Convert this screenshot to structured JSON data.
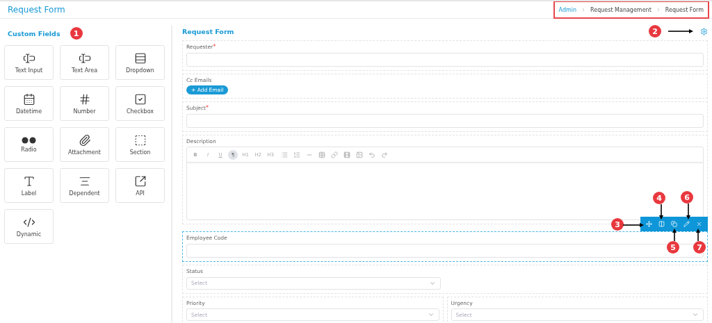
{
  "header": {
    "title": "Request Form",
    "breadcrumb": [
      {
        "label": "Admin",
        "link": true
      },
      {
        "label": "Request Management",
        "link": false
      },
      {
        "label": "Request Form",
        "link": false
      }
    ]
  },
  "custom_fields": {
    "title": "Custom Fields",
    "items": [
      {
        "label": "Text Input"
      },
      {
        "label": "Text Area"
      },
      {
        "label": "Dropdown"
      },
      {
        "label": "Datetime"
      },
      {
        "label": "Number"
      },
      {
        "label": "Checkbox"
      },
      {
        "label": "Radio"
      },
      {
        "label": "Attachment"
      },
      {
        "label": "Section"
      },
      {
        "label": "Label"
      },
      {
        "label": "Dependent"
      },
      {
        "label": "API"
      },
      {
        "label": "Dynamic"
      }
    ]
  },
  "form": {
    "title": "Request Form",
    "fields": [
      {
        "kind": "text",
        "label": "Requester",
        "required_mark": "*",
        "selected": false
      },
      {
        "kind": "emails",
        "label": "Cc Emails",
        "button": "+ Add Email",
        "selected": false
      },
      {
        "kind": "text",
        "label": "Subject",
        "required_mark": "*",
        "selected": false
      },
      {
        "kind": "editor",
        "label": "Description",
        "selected": false,
        "toolbar": [
          {
            "label": "B",
            "selected": false
          },
          {
            "label": "I",
            "selected": false
          },
          {
            "label": "U",
            "selected": false
          },
          {
            "label": "¶",
            "selected": true
          },
          {
            "label": "H1",
            "selected": false
          },
          {
            "label": "H2",
            "selected": false
          },
          {
            "label": "H3",
            "selected": false
          }
        ]
      },
      {
        "kind": "text",
        "label": "Employee Code",
        "selected": true
      },
      {
        "kind": "select",
        "label": "Status",
        "placeholder": "Select",
        "selected": false
      },
      {
        "kind": "select_pair",
        "selected": false,
        "items": [
          {
            "label": "Priority",
            "placeholder": "Select"
          },
          {
            "label": "Urgency",
            "placeholder": "Select"
          }
        ]
      }
    ]
  },
  "callouts": [
    {
      "number": "1"
    },
    {
      "number": "2"
    },
    {
      "number": "3"
    },
    {
      "number": "4"
    },
    {
      "number": "5"
    },
    {
      "number": "6"
    },
    {
      "number": "7"
    }
  ]
}
